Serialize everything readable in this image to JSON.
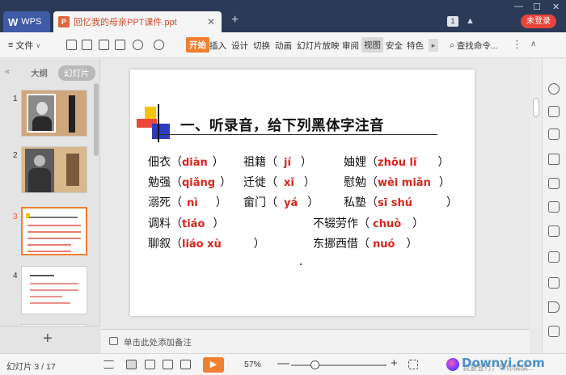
{
  "app": {
    "wps_tab": "WPS",
    "doc_tab": "回忆我的母亲PPT课件.ppt",
    "new_tab": "+",
    "badge_number": "1",
    "login_label": "未登录"
  },
  "toolbar": {
    "file_menu": "文件",
    "ribbon_tabs": [
      "开始",
      "插入",
      "设计",
      "切换",
      "动画",
      "幻灯片放映",
      "审阅",
      "视图",
      "安全",
      "特色"
    ],
    "search_cmd": "查找命令..."
  },
  "left_panel": {
    "tab_outline": "大纲",
    "tab_slides": "幻灯片",
    "slide_numbers": [
      "1",
      "2",
      "3",
      "4"
    ],
    "add_slide": "+"
  },
  "slide": {
    "title": "一、听录音，给下列黑体字注音",
    "rows": [
      {
        "cells": [
          {
            "prefix": "佃衣（",
            "py": "diàn",
            "suffix": "）"
          },
          {
            "prefix": "祖籍（",
            "py": "jí",
            "suffix": "）"
          },
          {
            "prefix": "妯娌（",
            "py": "zhǒu  lǐ",
            "suffix": "）"
          }
        ]
      },
      {
        "cells": [
          {
            "prefix": "勉强（",
            "py": "qiǎng",
            "suffix": "）"
          },
          {
            "prefix": "迁徙（",
            "py": "xǐ",
            "suffix": "）"
          },
          {
            "prefix": "慰勉（",
            "py": "wèi  miǎn",
            "suffix": "）"
          }
        ]
      },
      {
        "cells": [
          {
            "prefix": "溺死（",
            "py": "nì",
            "suffix": "）"
          },
          {
            "prefix": "畲门（",
            "py": "yá",
            "suffix": "）"
          },
          {
            "prefix": "私塾（",
            "py": "sī shú",
            "suffix": "）"
          }
        ]
      },
      {
        "cells": [
          {
            "prefix": "调料（",
            "py": "tiáo",
            "suffix": "）"
          },
          {
            "prefix": "不辍劳作（",
            "py": "chuò",
            "suffix": "）"
          }
        ]
      },
      {
        "cells": [
          {
            "prefix": "聊叙（",
            "py": "liáo xù",
            "suffix": "）"
          },
          {
            "prefix": "东挪西借（",
            "py": "nuó",
            "suffix": "）"
          }
        ]
      }
    ]
  },
  "notes": {
    "placeholder": "单击此处添加备注"
  },
  "status": {
    "slide_count": "幻灯片 3 / 17",
    "zoom": "57%",
    "zoom_minus": "—",
    "zoom_plus": "+",
    "watermark": "Downyi.com",
    "watermark_sub": "我要登行，带你搞搞..."
  },
  "colors": {
    "accent_orange": "#f07f2f",
    "pinyin_red": "#d8261a",
    "titlebar": "#2b3b57",
    "login_red": "#e8443a"
  },
  "icons": [
    "search-icon",
    "save-icon",
    "print-icon",
    "undo-icon",
    "redo-icon",
    "play-icon",
    "plus-icon",
    "close-icon"
  ]
}
